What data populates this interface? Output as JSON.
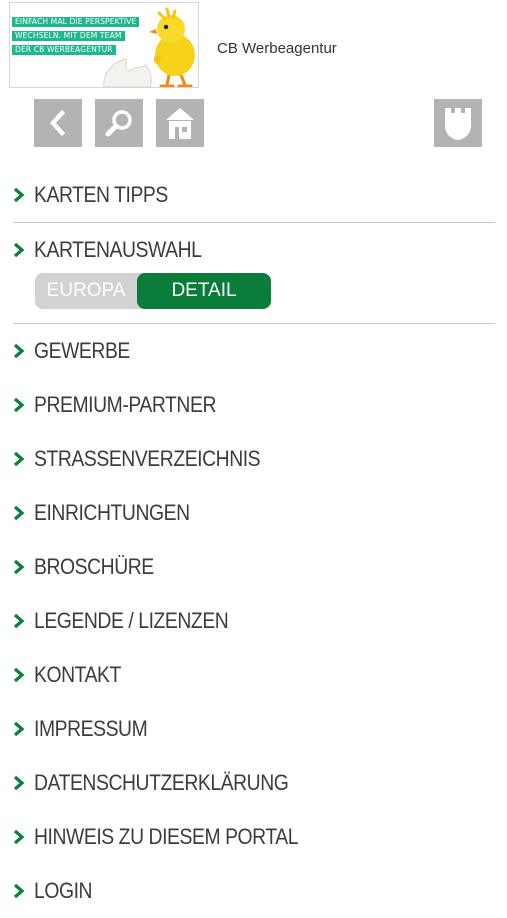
{
  "header": {
    "logo_lines": [
      "EINFACH MAL DIE PERSPEKTIVE",
      "WECHSELN. MIT DEM TEAM",
      "DER CB WERBEAGENTUR"
    ],
    "brand": "CB Werbeagentur"
  },
  "toolbar": {
    "icons": [
      "back-icon",
      "search-icon",
      "home-icon",
      "castle-icon"
    ]
  },
  "menu": {
    "karten_tipps": "KARTEN TIPPS",
    "kartenauswahl": "KARTENAUSWAHL",
    "toggle": {
      "left": "EUROPA",
      "right": "DETAIL",
      "selected": "DETAIL"
    },
    "items": [
      "GEWERBE",
      "PREMIUM-PARTNER",
      "STRASSENVERZEICHNIS",
      "EINRICHTUNGEN",
      "BROSCHÜRE",
      "LEGENDE / LIZENZEN",
      "KONTAKT",
      "IMPRESSUM",
      "DATENSCHUTZERKLÄRUNG",
      "HINWEIS ZU DIESEM PORTAL",
      "LOGIN"
    ]
  },
  "colors": {
    "accent": "#0a7d3b",
    "icon_bg": "#b3b3b3",
    "logo_text_bg": "#1fb88e"
  }
}
